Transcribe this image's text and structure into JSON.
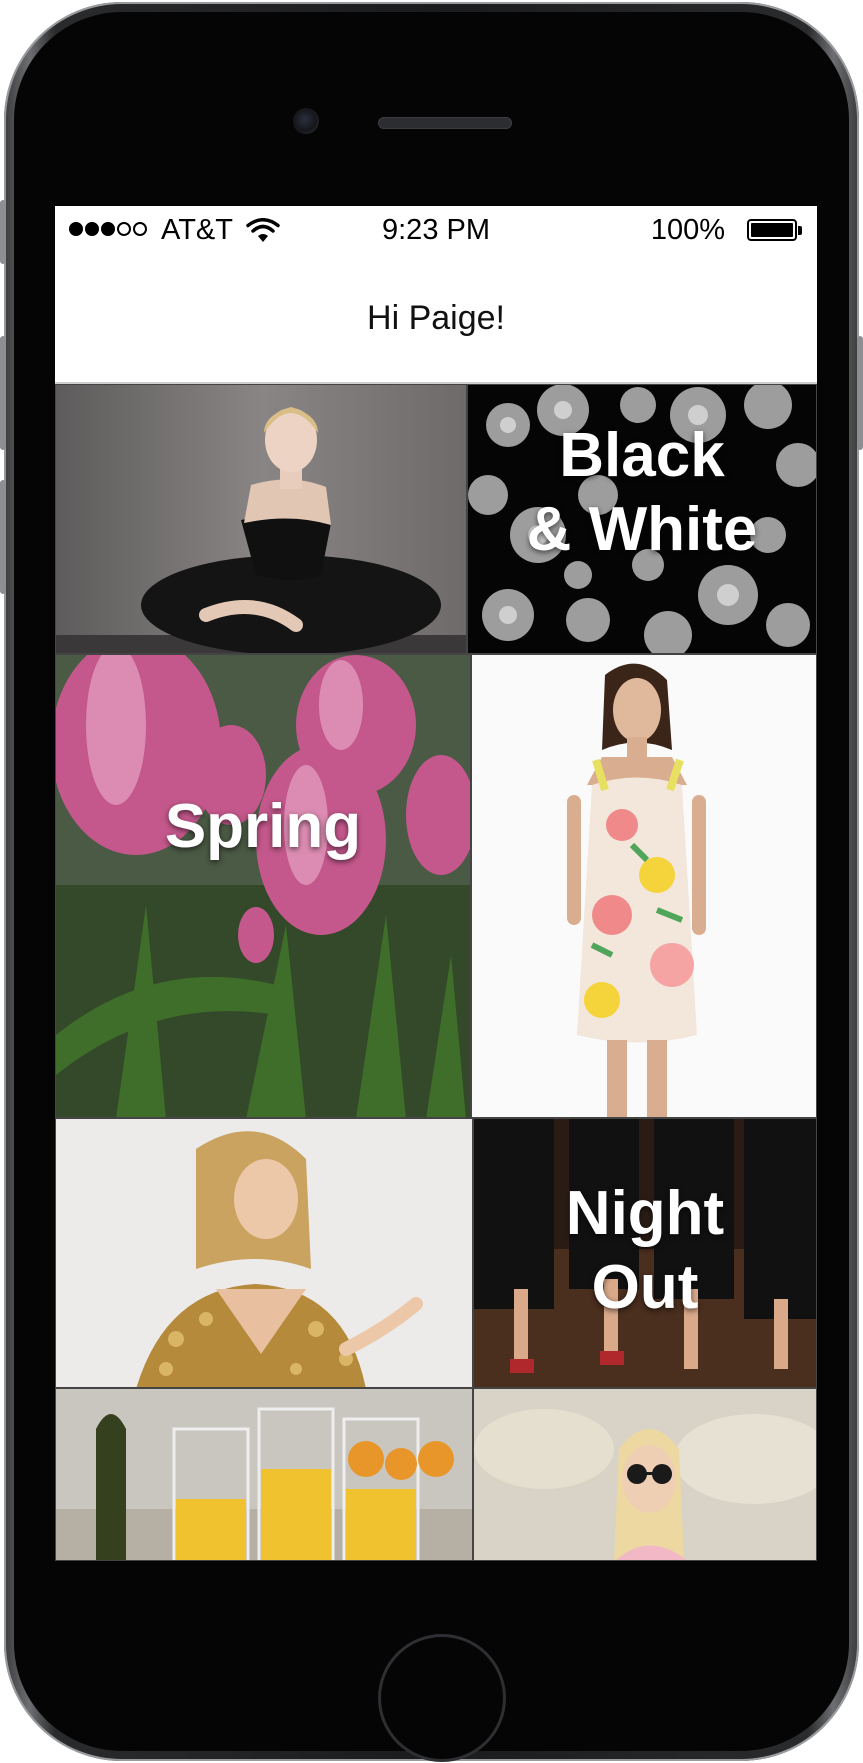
{
  "status_bar": {
    "carrier": "AT&T",
    "time": "9:23 PM",
    "battery_percent": "100%",
    "signal_bars_filled": 3,
    "signal_bars_total": 5,
    "wifi_icon": "wifi-icon",
    "battery_icon": "battery-full-icon"
  },
  "nav": {
    "title": "Hi Paige!"
  },
  "tiles": [
    {
      "label": "",
      "image": "woman in black strapless tulle dress photo"
    },
    {
      "label": "Black\n& White",
      "line1": "Black",
      "line2": "& White"
    },
    {
      "label": "Spring",
      "line1": "Spring"
    },
    {
      "label": "",
      "image": "woman in floral print dress photo"
    },
    {
      "label": "",
      "image": "blonde woman in gold sequin top photo"
    },
    {
      "label": "Night Out",
      "line1": "Night",
      "line2": "Out"
    },
    {
      "label": "",
      "image": "glasses of orange juice with bottle photo"
    },
    {
      "label": "",
      "image": "blonde woman with sunglasses photo"
    }
  ],
  "colors": {
    "phone_body": "#1a1b1d",
    "screen_bg": "#ffffff",
    "label_text": "#ffffff",
    "tulip_pink": "#c4588c"
  }
}
